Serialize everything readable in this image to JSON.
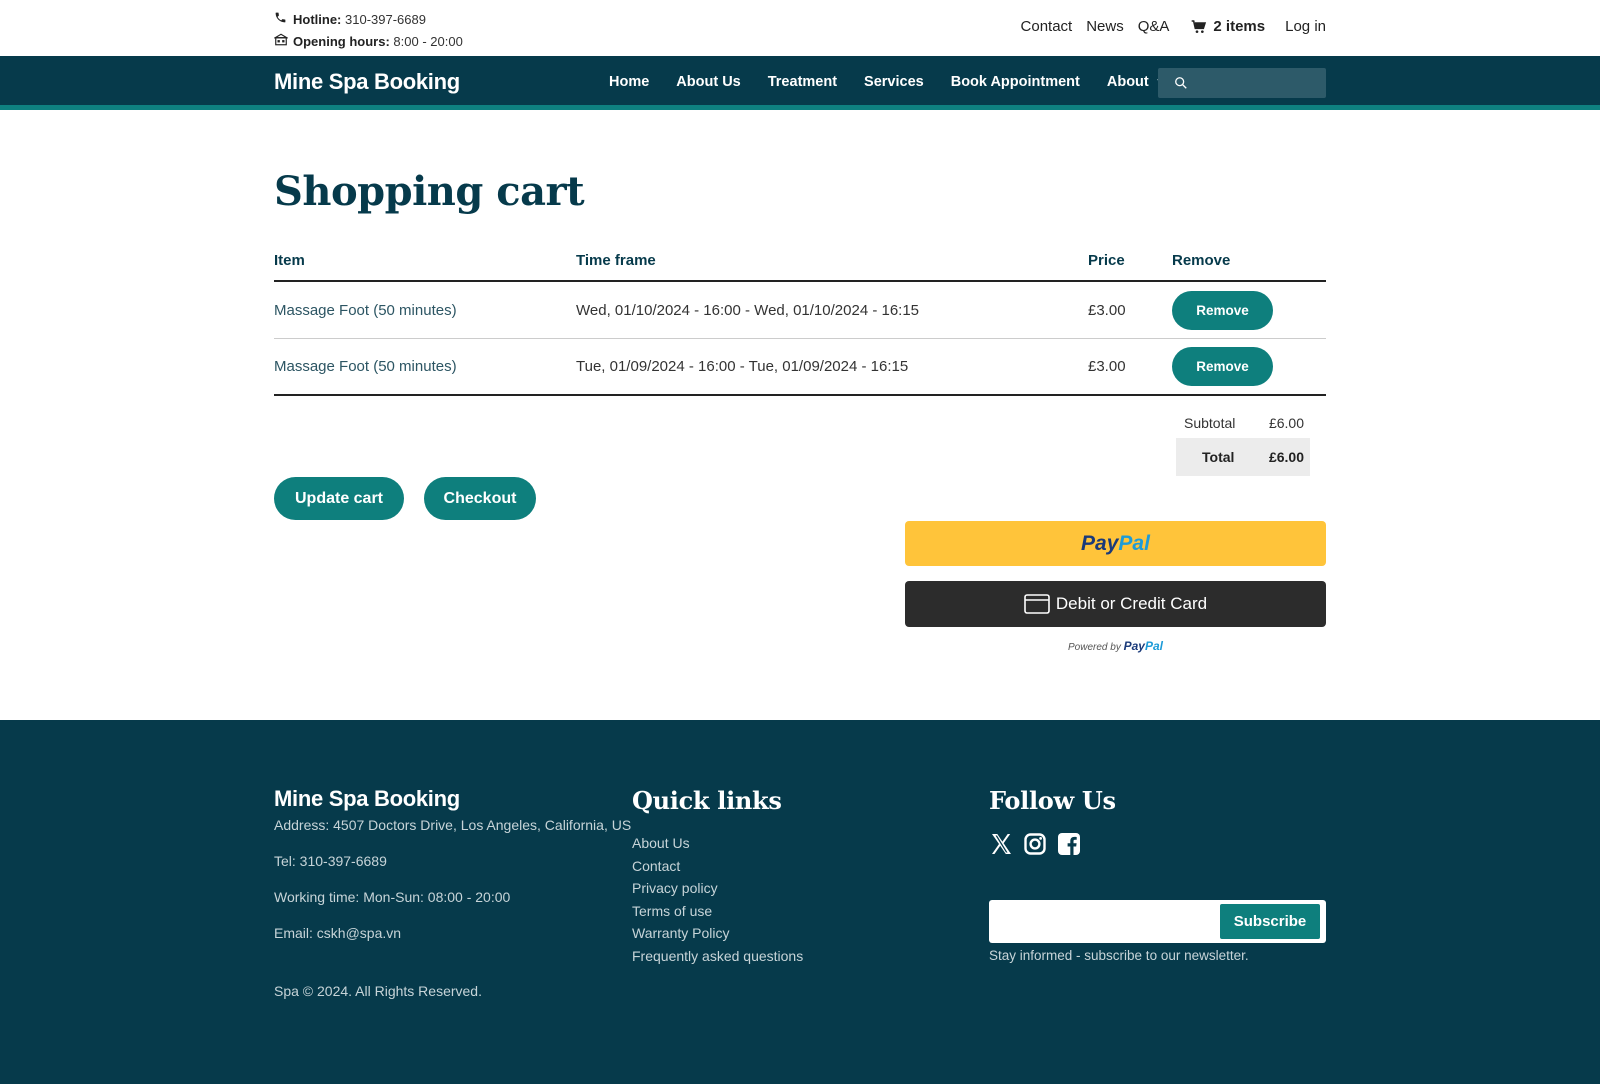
{
  "topbar": {
    "hotline_label": "Hotline:",
    "hotline_value": "310-397-6689",
    "hours_label": "Opening hours:",
    "hours_value": "8:00 - 20:00",
    "links": {
      "contact": "Contact",
      "news": "News",
      "qa": "Q&A",
      "cart": "2 items",
      "login": "Log in"
    }
  },
  "nav": {
    "brand": "Mine Spa Booking",
    "items": {
      "home": "Home",
      "about_us": "About Us",
      "treatment": "Treatment",
      "services": "Services",
      "book": "Book Appointment",
      "about": "About"
    },
    "search_placeholder": ""
  },
  "main": {
    "title": "Shopping cart",
    "columns": {
      "item": "Item",
      "timeframe": "Time frame",
      "price": "Price",
      "remove": "Remove"
    },
    "rows": [
      {
        "item": "Massage Foot (50 minutes)",
        "timeframe": "Wed, 01/10/2024 - 16:00 - Wed, 01/10/2024 - 16:15",
        "price": "£3.00",
        "remove_label": "Remove"
      },
      {
        "item": "Massage Foot (50 minutes)",
        "timeframe": "Tue, 01/09/2024 - 16:00 - Tue, 01/09/2024 - 16:15",
        "price": "£3.00",
        "remove_label": "Remove"
      }
    ],
    "totals": {
      "subtotal_label": "Subtotal",
      "subtotal_value": "£6.00",
      "total_label": "Total",
      "total_value": "£6.00"
    },
    "update_label": "Update cart",
    "checkout_label": "Checkout",
    "paypal": {
      "pay": "Pay",
      "pal": "Pal",
      "card_label": "Debit or Credit Card",
      "powered_by": "Powered by"
    }
  },
  "footer": {
    "brand": "Mine Spa Booking",
    "address": "Address: 4507 Doctors Drive, Los Angeles, California, US",
    "tel": "Tel: 310-397-6689",
    "working": "Working time: Mon-Sun: 08:00 - 20:00",
    "email": "Email: cskh@spa.vn",
    "copyright": "Spa © 2024. All Rights Reserved.",
    "quick_links_title": "Quick links",
    "quick_links": [
      "About Us",
      "Contact",
      "Privacy policy",
      "Terms of use",
      "Warranty Policy",
      "Frequently asked questions"
    ],
    "follow_title": "Follow Us",
    "subscribe_label": "Subscribe",
    "subscribe_note": "Stay informed - subscribe to our newsletter."
  },
  "colors": {
    "navy": "#063a4b",
    "teal": "#0e7f7d",
    "paypal_yellow": "#ffc43a"
  },
  "icons": [
    "phone-icon",
    "store-icon",
    "cart-icon",
    "chevron-down-icon",
    "search-icon",
    "card-icon",
    "x-twitter-icon",
    "instagram-icon",
    "facebook-icon"
  ]
}
